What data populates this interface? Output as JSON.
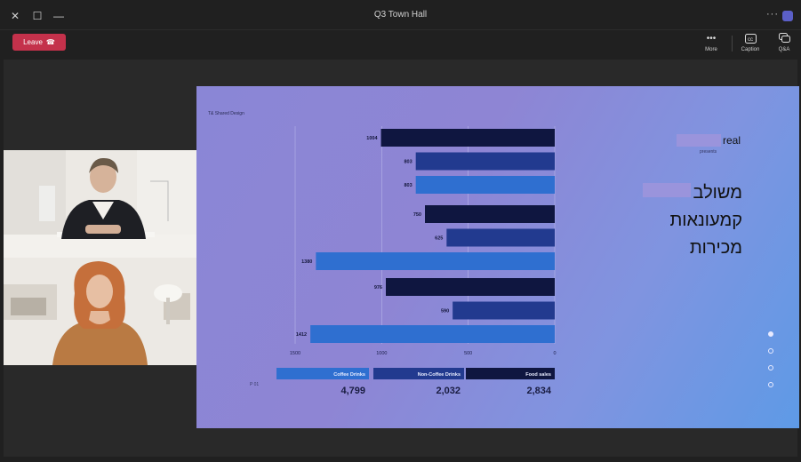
{
  "window": {
    "title": "Q3 Town Hall"
  },
  "toolbar": {
    "leave_label": "Leave",
    "items": [
      {
        "label": "More",
        "icon": "more-icon"
      },
      {
        "label": "Caption",
        "icon": "caption-icon"
      },
      {
        "label": "Q&A",
        "icon": "qa-icon"
      }
    ]
  },
  "colors": {
    "leave": "#c4314b",
    "dark_bar": "#0f1640",
    "mid_bar": "#223a8f",
    "light_bar": "#2f6fd0"
  },
  "slide": {
    "brand": "T& Shared Design",
    "real_text": "real",
    "presents_text": "presents",
    "headline_lines": [
      "משולב",
      "קמעונאות",
      "מכירות"
    ],
    "page_label": "P 01",
    "nav_dots": 4,
    "active_dot": 0
  },
  "chart_data": {
    "type": "bar",
    "orientation": "horizontal",
    "groups": [
      {
        "values": [
          1004,
          803,
          803
        ]
      },
      {
        "values": [
          750,
          625,
          1380
        ]
      },
      {
        "values": [
          976,
          590,
          1412
        ]
      }
    ],
    "series": [
      {
        "name": "Food sales",
        "total": "2,834"
      },
      {
        "name": "Non-Coffee Drinks",
        "total": "2,032"
      },
      {
        "name": "Coffee Drinks",
        "total": "4,799"
      }
    ],
    "x_ticks": [
      "0",
      "500",
      "1000",
      "1500"
    ],
    "xlim": [
      0,
      1500
    ]
  }
}
